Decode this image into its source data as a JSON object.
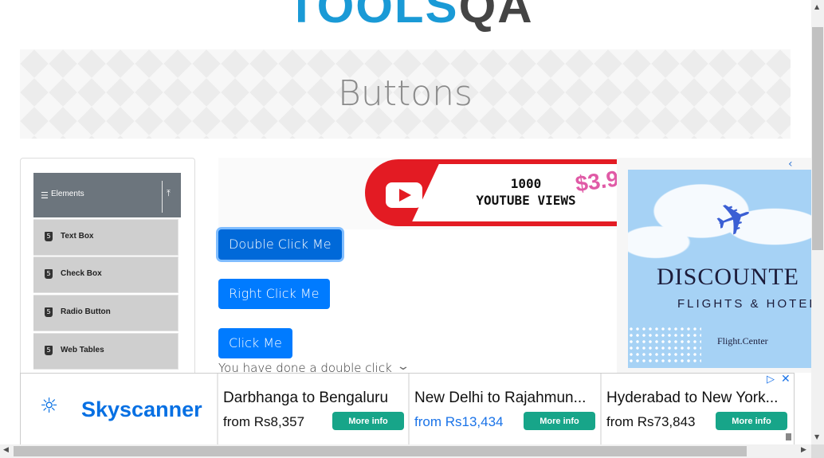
{
  "header": {
    "logo_main": "TOOLS",
    "logo_accent": "QA"
  },
  "page": {
    "title": "Buttons"
  },
  "sidebar": {
    "group": {
      "label": "Elements",
      "menu_icon": "hamburger-icon",
      "collapse_icon": "collapse-icon"
    },
    "items": [
      {
        "label": "Text Box",
        "icon": "html5-icon"
      },
      {
        "label": "Check Box",
        "icon": "html5-icon"
      },
      {
        "label": "Radio Button",
        "icon": "html5-icon"
      },
      {
        "label": "Web Tables",
        "icon": "html5-icon"
      }
    ]
  },
  "youtube_ad": {
    "line1": "1000",
    "line2": "YOUTUBE VIEWS",
    "price": "$3.9"
  },
  "buttons": {
    "double_click": "Double Click Me",
    "right_click": "Right Click Me",
    "click": "Click Me"
  },
  "result": {
    "message": "You have done a double click"
  },
  "flight_ad": {
    "title": "DISCOUNTE",
    "subtitle": "FLIGHTS & HOTEL",
    "brand": "Flight.Center",
    "close_icon": "chevron-left-icon"
  },
  "bottom_ad": {
    "brand": "Skyscanner",
    "deals": [
      {
        "route": "Darbhanga to Bengaluru",
        "price": "from Rs8,357",
        "cta": "More info"
      },
      {
        "route": "New Delhi to Rajahmun...",
        "price": "from Rs13,434",
        "cta": "More info"
      },
      {
        "route": "Hyderabad to New York...",
        "price": "from Rs73,843",
        "cta": "More info"
      }
    ]
  },
  "colors": {
    "primary": "#007bff",
    "brand_blue": "#1a9ad6",
    "sidebar_header": "#6c757d",
    "skyscanner": "#0770e3",
    "cta_green": "#17a589"
  }
}
